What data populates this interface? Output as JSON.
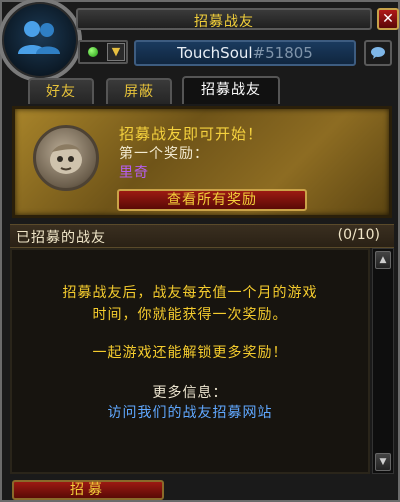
{
  "window": {
    "title": "招募战友"
  },
  "header": {
    "battletag_name": "TouchSoul",
    "battletag_number": "#51805",
    "status_icon": "online-dot-icon",
    "status_dropdown_icon": "down-arrow-icon",
    "chat_icon": "chat-bubble-icon",
    "close_label": "✕"
  },
  "tabs": [
    {
      "label": "好友"
    },
    {
      "label": "屏蔽"
    },
    {
      "label": "招募战友"
    }
  ],
  "reward": {
    "headline": "招募战友即可开始！",
    "first_reward_label": "第一个奖励：",
    "first_reward_name": "里奇",
    "view_all_button": "查看所有奖励"
  },
  "recruited": {
    "title": "已招募的战友",
    "count": "(0/10)",
    "message_line1": "招募战友后，战友每充值一个月的游戏",
    "message_line2": "时间，你就能获得一次奖励。",
    "message_line3": "一起游戏还能解锁更多奖励！",
    "more_info_label": "更多信息：",
    "more_info_link": "访问我们的战友招募网站"
  },
  "footer": {
    "recruit_button": "招募"
  },
  "colors": {
    "gold": "#f5cc2e",
    "purple": "#b65ef0",
    "link_blue": "#60a8ff",
    "red_button": "#9c1a12"
  }
}
